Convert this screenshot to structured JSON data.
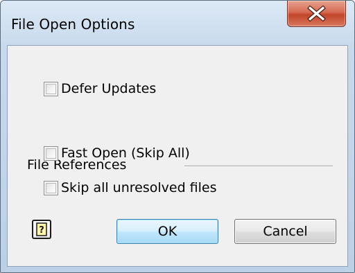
{
  "window": {
    "title": "File Open Options"
  },
  "options": {
    "defer_updates": {
      "label": "Defer Updates",
      "checked": false
    }
  },
  "file_references": {
    "section_label": "File References",
    "fast_open": {
      "label": "Fast Open (Skip All)",
      "checked": false
    },
    "skip_unresolved": {
      "label": "Skip all unresolved files",
      "checked": false
    }
  },
  "buttons": {
    "ok_label": "OK",
    "cancel_label": "Cancel",
    "help_icon": "help-question-icon"
  },
  "colors": {
    "title_bar": "#c7d9ec",
    "close_button": "#c14529",
    "client_background": "#f0f0f0",
    "default_button_border": "#3c7fb1"
  },
  "icons": {
    "close": "close-x-icon",
    "help": "help-question-icon"
  }
}
